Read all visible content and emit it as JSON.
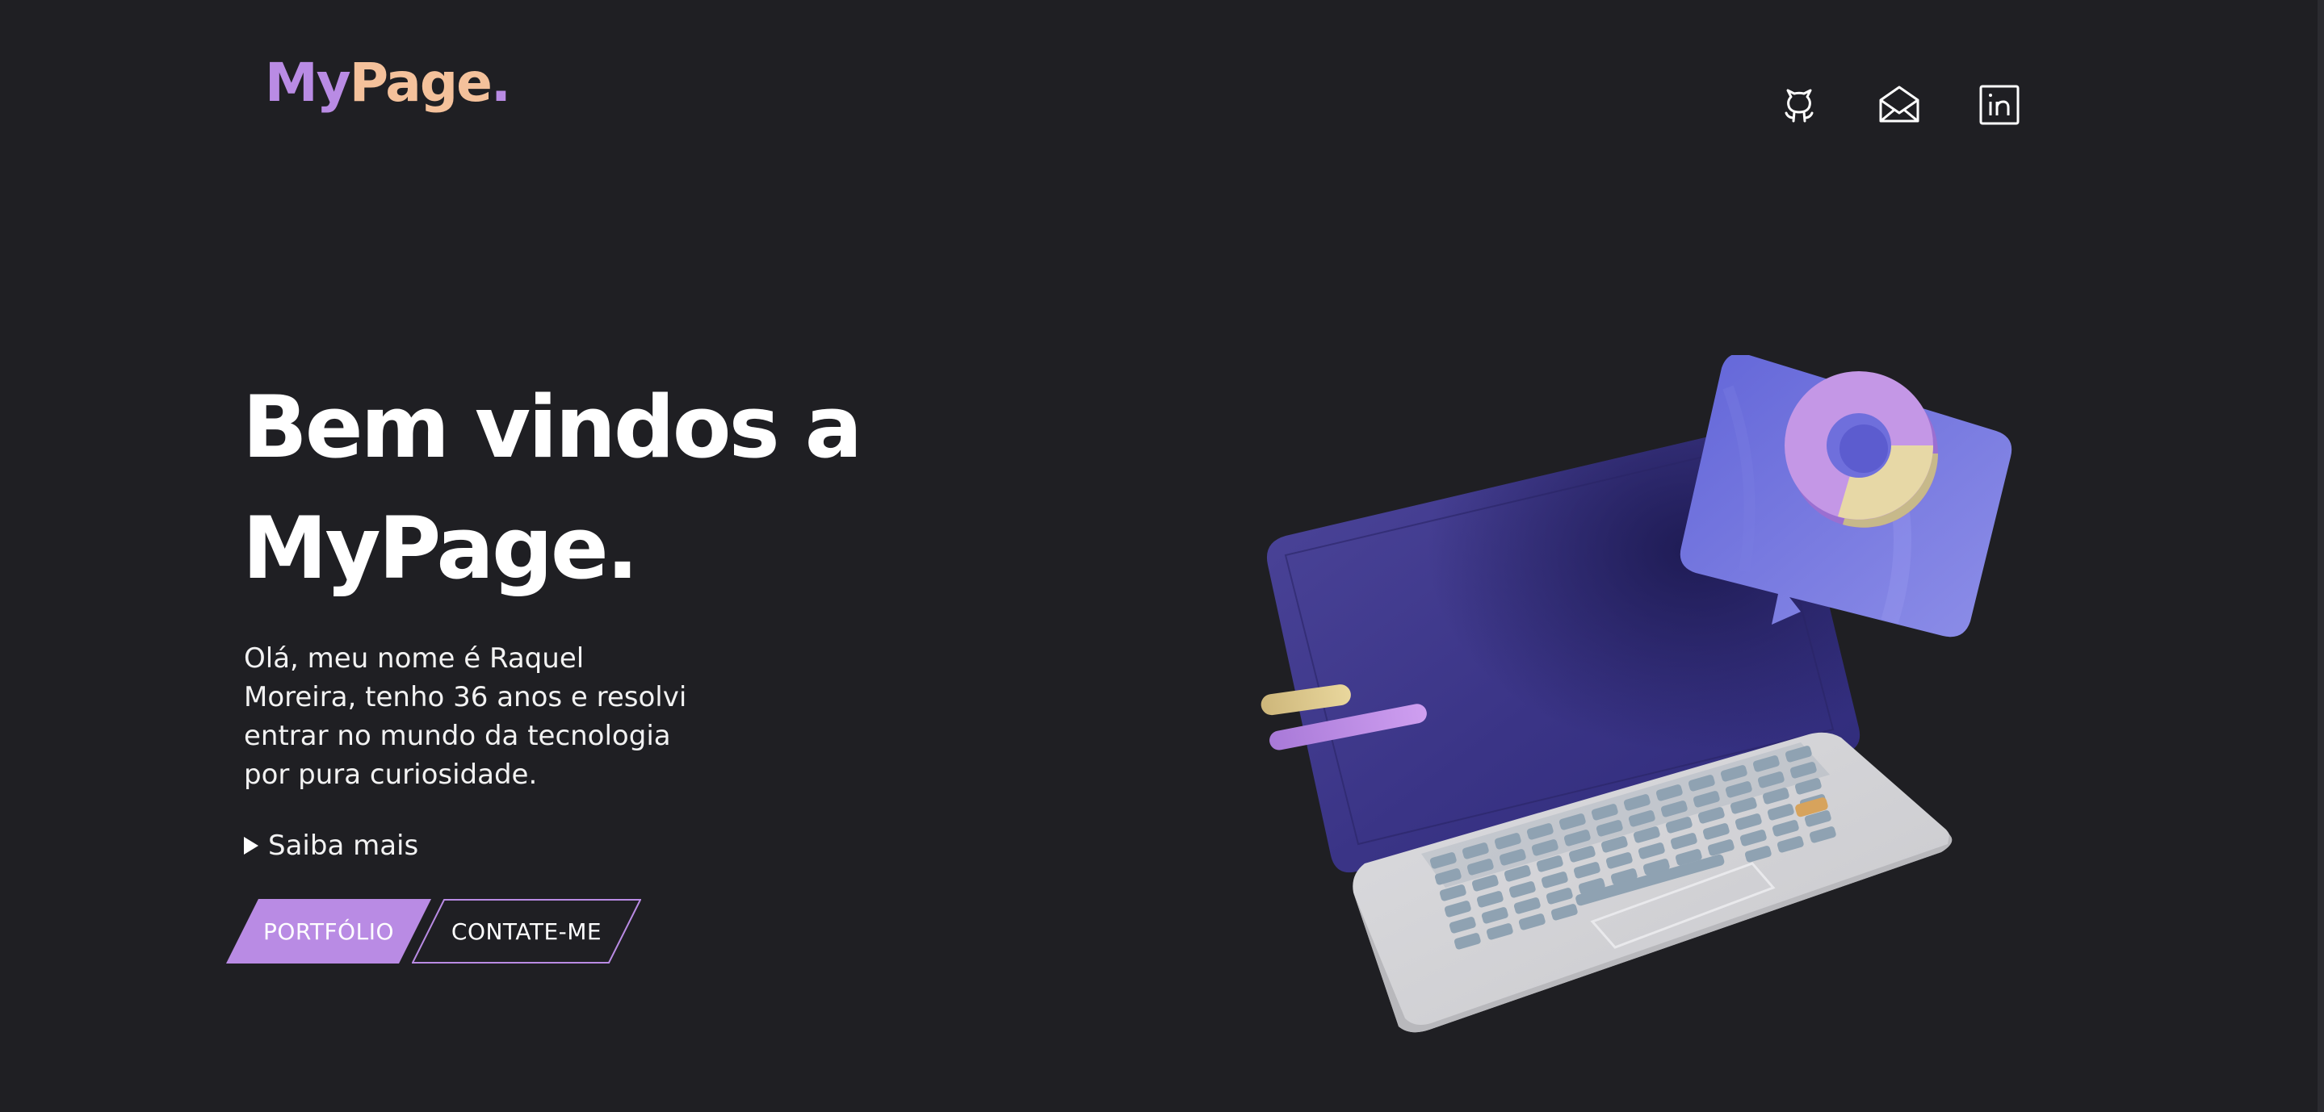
{
  "header": {
    "logo": {
      "my": "My",
      "page": "Page",
      "dot": "."
    },
    "social": [
      {
        "name": "github",
        "icon": "github-icon"
      },
      {
        "name": "email",
        "icon": "envelope-icon"
      },
      {
        "name": "linkedin",
        "icon": "linkedin-icon"
      }
    ]
  },
  "hero": {
    "title_line1": "Bem vindos a",
    "title_line2": "MyPage.",
    "intro": "Olá, meu nome é Raquel Moreira, tenho 36 anos e resolvi entrar no mundo da tecnologia por pura curiosidade.",
    "more_label": "Saiba mais",
    "buttons": {
      "portfolio": "PORTFÓLIO",
      "contact": "CONTATE-ME"
    }
  },
  "colors": {
    "background": "#1f1f23",
    "accent_purple": "#b98be4",
    "accent_peach": "#f4c19b",
    "text": "#ffffff"
  }
}
